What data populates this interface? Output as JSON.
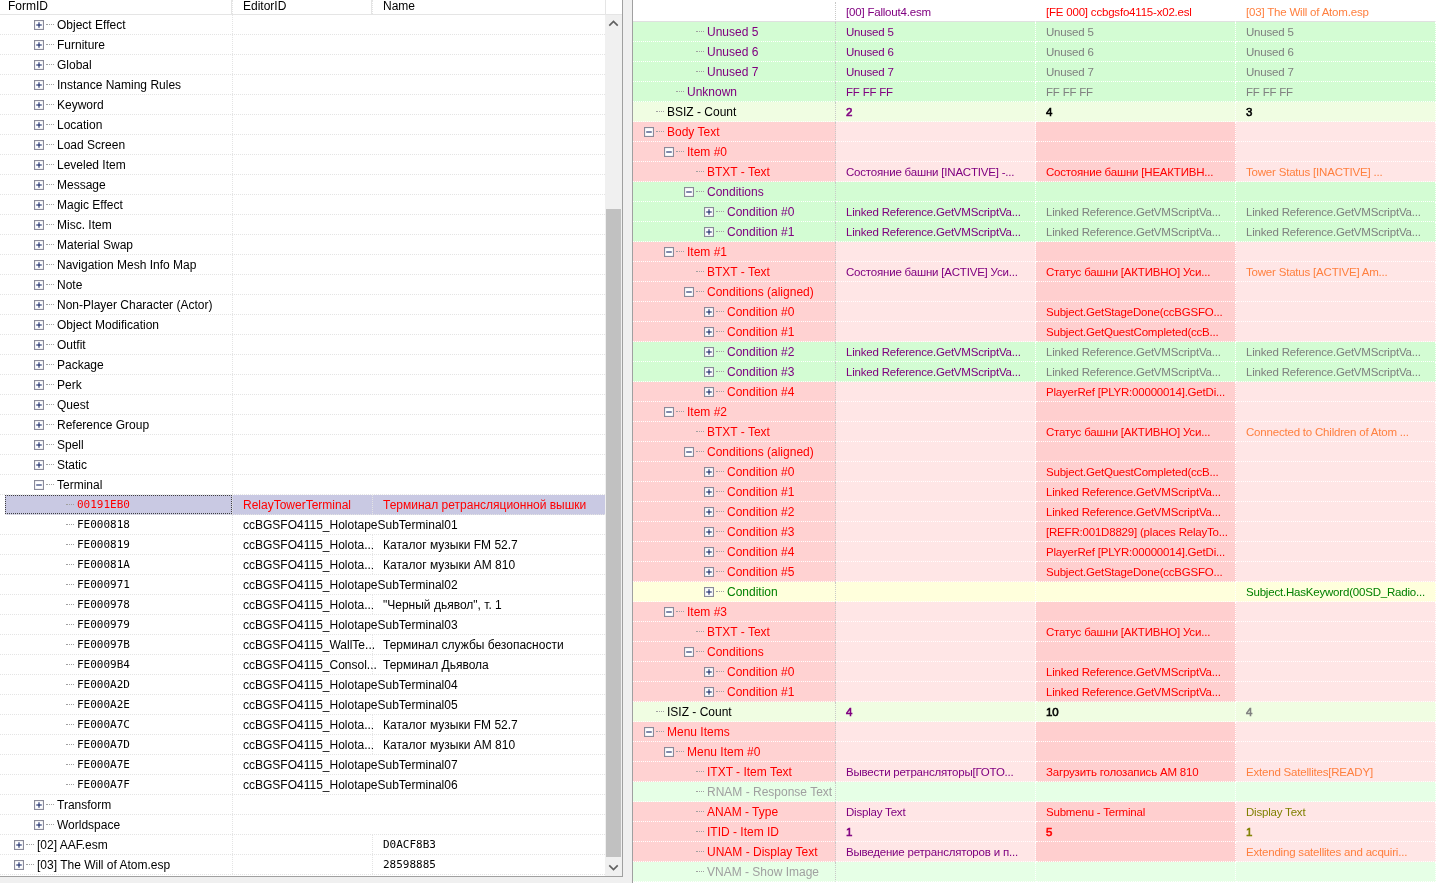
{
  "left_pane": {
    "columns": [
      "FormID",
      "EditorID",
      "Name"
    ],
    "tree": [
      {
        "children": [
          {
            "label": "Object Effect",
            "expanded": false
          },
          {
            "label": "Furniture",
            "expanded": false
          },
          {
            "label": "Global",
            "expanded": false
          },
          {
            "label": "Instance Naming Rules",
            "expanded": false
          },
          {
            "label": "Keyword",
            "expanded": false
          },
          {
            "label": "Location",
            "expanded": false
          },
          {
            "label": "Load Screen",
            "expanded": false
          },
          {
            "label": "Leveled Item",
            "expanded": false
          },
          {
            "label": "Message",
            "expanded": false
          },
          {
            "label": "Magic Effect",
            "expanded": false
          },
          {
            "label": "Misc. Item",
            "expanded": false
          },
          {
            "label": "Material Swap",
            "expanded": false
          },
          {
            "label": "Navigation Mesh Info Map",
            "expanded": false
          },
          {
            "label": "Note",
            "expanded": false
          },
          {
            "label": "Non-Player Character (Actor)",
            "expanded": false
          },
          {
            "label": "Object Modification",
            "expanded": false
          },
          {
            "label": "Outfit",
            "expanded": false
          },
          {
            "label": "Package",
            "expanded": false
          },
          {
            "label": "Perk",
            "expanded": false
          },
          {
            "label": "Quest",
            "expanded": false
          },
          {
            "label": "Reference Group",
            "expanded": false
          },
          {
            "label": "Spell",
            "expanded": false
          },
          {
            "label": "Static",
            "expanded": false
          },
          {
            "label": "Terminal",
            "expanded": true,
            "children": [
              {
                "form_id": "00191EB0",
                "editor_id": "RelayTowerTerminal",
                "name": "Терминал ретрансляционной вышки",
                "selected": true
              },
              {
                "form_id": "FE000818",
                "editor_id": "ccBGSFO4115_HolotapeSubTerminal01",
                "selected": false
              },
              {
                "form_id": "FE000819",
                "editor_id": "ccBGSFO4115_Holota...",
                "name": "Каталог музыки FM 52.7",
                "selected": false
              },
              {
                "form_id": "FE00081A",
                "editor_id": "ccBGSFO4115_Holota...",
                "name": "Каталог музыки AM 810",
                "selected": false
              },
              {
                "form_id": "FE000971",
                "editor_id": "ccBGSFO4115_HolotapeSubTerminal02",
                "selected": false
              },
              {
                "form_id": "FE000978",
                "editor_id": "ccBGSFO4115_Holota...",
                "name": "\"Черный дьявол\", т. 1",
                "selected": false
              },
              {
                "form_id": "FE000979",
                "editor_id": "ccBGSFO4115_HolotapeSubTerminal03",
                "selected": false
              },
              {
                "form_id": "FE00097B",
                "editor_id": "ccBGSFO4115_WallTe...",
                "name": "Терминал службы безопасности",
                "selected": false
              },
              {
                "form_id": "FE0009B4",
                "editor_id": "ccBGSFO4115_Consol...",
                "name": "Терминал Дьявола",
                "selected": false
              },
              {
                "form_id": "FE000A2D",
                "editor_id": "ccBGSFO4115_HolotapeSubTerminal04",
                "selected": false
              },
              {
                "form_id": "FE000A2E",
                "editor_id": "ccBGSFO4115_HolotapeSubTerminal05",
                "selected": false
              },
              {
                "form_id": "FE000A7C",
                "editor_id": "ccBGSFO4115_Holota...",
                "name": "Каталог музыки FM 52.7",
                "selected": false
              },
              {
                "form_id": "FE000A7D",
                "editor_id": "ccBGSFO4115_Holota...",
                "name": "Каталог музыки AM 810",
                "selected": false
              },
              {
                "form_id": "FE000A7E",
                "editor_id": "ccBGSFO4115_HolotapeSubTerminal07",
                "selected": false
              },
              {
                "form_id": "FE000A7F",
                "editor_id": "ccBGSFO4115_HolotapeSubTerminal06",
                "selected": false
              }
            ]
          },
          {
            "label": "Transform",
            "expanded": false
          },
          {
            "label": "Worldspace",
            "expanded": false
          }
        ]
      },
      {
        "label": "[02] AAF.esm",
        "expanded": false,
        "name": "D0ACF8B3"
      },
      {
        "label": "[03] The Will of Atom.esp",
        "expanded": false,
        "name": "28598885"
      }
    ]
  },
  "right_pane": {
    "columns": [
      {
        "label": "[00] Fallout4.esm",
        "color": "#800080"
      },
      {
        "label": "[FE 000] ccbgsfo4115-x02.esl",
        "color": "#ff0000"
      },
      {
        "label": "[03] The Will of Atom.esp",
        "color": "#ff8040"
      }
    ],
    "records": [
      {
        "children": [
          {
            "children": [
              {
                "label": "Unused 5",
                "color": "#800080",
                "kind": "match",
                "fallout4": {
                  "text": "Unused 5",
                  "color": "#800080"
                },
                "ccbgsfo4115": {
                  "text": "Unused 5",
                  "color": "#808080"
                },
                "will_of_atom": {
                  "text": "Unused 5",
                  "color": "#808080"
                }
              },
              {
                "label": "Unused 6",
                "color": "#800080",
                "kind": "match",
                "fallout4": {
                  "text": "Unused 6",
                  "color": "#800080"
                },
                "ccbgsfo4115": {
                  "text": "Unused 6",
                  "color": "#808080"
                },
                "will_of_atom": {
                  "text": "Unused 6",
                  "color": "#808080"
                }
              },
              {
                "label": "Unused 7",
                "color": "#800080",
                "kind": "match",
                "fallout4": {
                  "text": "Unused 7",
                  "color": "#800080"
                },
                "ccbgsfo4115": {
                  "text": "Unused 7",
                  "color": "#808080"
                },
                "will_of_atom": {
                  "text": "Unused 7",
                  "color": "#808080"
                }
              }
            ]
          },
          {
            "label": "Unknown",
            "color": "#800080",
            "kind": "match",
            "fallout4": {
              "text": "FF FF FF",
              "color": "#800080"
            },
            "ccbgsfo4115": {
              "text": "FF FF FF",
              "color": "#808080"
            },
            "will_of_atom": {
              "text": "FF FF FF",
              "color": "#808080"
            }
          }
        ]
      },
      {
        "label": "BSIZ - Count",
        "color": "#000000",
        "kind": "benign",
        "fallout4": {
          "text": "2",
          "color": "#800080"
        },
        "ccbgsfo4115": {
          "text": "4",
          "color": "#000000"
        },
        "will_of_atom": {
          "text": "3",
          "color": "#000000"
        }
      },
      {
        "label": "Body Text",
        "color": "#ff0000",
        "kind": "conflict",
        "expanded": true,
        "children": [
          {
            "label": "Item #0",
            "color": "#ff0000",
            "kind": "conflict",
            "expanded": true,
            "children": [
              {
                "label": "BTXT - Text",
                "color": "#ff0000",
                "kind": "conflict",
                "fallout4": {
                  "text": "Состояние башни [INACTIVE] -...",
                  "color": "#800080"
                },
                "ccbgsfo4115": {
                  "text": "Состояние башни [НЕАКТИВН...",
                  "color": "#ff0000"
                },
                "will_of_atom": {
                  "text": "Tower Status [INACTIVE] ...",
                  "color": "#ff8040"
                }
              },
              {
                "label": "Conditions",
                "color": "#800080",
                "kind": "match",
                "expanded": true,
                "children": [
                  {
                    "label": "Condition #0",
                    "color": "#800080",
                    "kind": "match",
                    "expanded": false,
                    "fallout4": {
                      "text": "Linked Reference.GetVMScriptVa...",
                      "color": "#800080"
                    },
                    "ccbgsfo4115": {
                      "text": "Linked Reference.GetVMScriptVa...",
                      "color": "#808080"
                    },
                    "will_of_atom": {
                      "text": "Linked Reference.GetVMScriptVa...",
                      "color": "#808080"
                    }
                  },
                  {
                    "label": "Condition #1",
                    "color": "#800080",
                    "kind": "match",
                    "expanded": false,
                    "fallout4": {
                      "text": "Linked Reference.GetVMScriptVa...",
                      "color": "#800080"
                    },
                    "ccbgsfo4115": {
                      "text": "Linked Reference.GetVMScriptVa...",
                      "color": "#808080"
                    },
                    "will_of_atom": {
                      "text": "Linked Reference.GetVMScriptVa...",
                      "color": "#808080"
                    }
                  }
                ]
              }
            ]
          },
          {
            "label": "Item #1",
            "color": "#ff0000",
            "kind": "conflict",
            "expanded": true,
            "children": [
              {
                "label": "BTXT - Text",
                "color": "#ff0000",
                "kind": "conflict",
                "fallout4": {
                  "text": "Состояние башни [ACTIVE] Уси...",
                  "color": "#800080"
                },
                "ccbgsfo4115": {
                  "text": "Статус башни [АКТИВНО] Уси...",
                  "color": "#ff0000"
                },
                "will_of_atom": {
                  "text": "Tower Status [ACTIVE] Am...",
                  "color": "#ff8040"
                }
              },
              {
                "label": "Conditions (aligned)",
                "color": "#ff0000",
                "kind": "conflict",
                "expanded": true,
                "children": [
                  {
                    "label": "Condition #0",
                    "color": "#ff0000",
                    "kind": "conflict",
                    "expanded": false,
                    "ccbgsfo4115": {
                      "text": "Subject.GetStageDone(ccBGSFO...",
                      "color": "#ff0000"
                    }
                  },
                  {
                    "label": "Condition #1",
                    "color": "#ff0000",
                    "kind": "conflict",
                    "expanded": false,
                    "ccbgsfo4115": {
                      "text": "Subject.GetQuestCompleted(ccB...",
                      "color": "#ff0000"
                    }
                  },
                  {
                    "label": "Condition #2",
                    "color": "#800080",
                    "kind": "match",
                    "expanded": false,
                    "fallout4": {
                      "text": "Linked Reference.GetVMScriptVa...",
                      "color": "#800080"
                    },
                    "ccbgsfo4115": {
                      "text": "Linked Reference.GetVMScriptVa...",
                      "color": "#808080"
                    },
                    "will_of_atom": {
                      "text": "Linked Reference.GetVMScriptVa...",
                      "color": "#808080"
                    }
                  },
                  {
                    "label": "Condition #3",
                    "color": "#800080",
                    "kind": "match",
                    "expanded": false,
                    "fallout4": {
                      "text": "Linked Reference.GetVMScriptVa...",
                      "color": "#800080"
                    },
                    "ccbgsfo4115": {
                      "text": "Linked Reference.GetVMScriptVa...",
                      "color": "#808080"
                    },
                    "will_of_atom": {
                      "text": "Linked Reference.GetVMScriptVa...",
                      "color": "#808080"
                    }
                  },
                  {
                    "label": "Condition #4",
                    "color": "#ff0000",
                    "kind": "conflict",
                    "expanded": false,
                    "ccbgsfo4115": {
                      "text": "PlayerRef [PLYR:00000014].GetDi...",
                      "color": "#ff0000"
                    }
                  }
                ]
              }
            ]
          },
          {
            "label": "Item #2",
            "color": "#ff0000",
            "kind": "conflict",
            "expanded": true,
            "children": [
              {
                "label": "BTXT - Text",
                "color": "#ff0000",
                "kind": "conflict",
                "ccbgsfo4115": {
                  "text": "Статус башни [АКТИВНО] Уси...",
                  "color": "#ff0000"
                },
                "will_of_atom": {
                  "text": "Connected to Children of Atom ...",
                  "color": "#ff8040"
                }
              },
              {
                "label": "Conditions (aligned)",
                "color": "#ff0000",
                "kind": "conflict",
                "expanded": true,
                "children": [
                  {
                    "label": "Condition #0",
                    "color": "#ff0000",
                    "kind": "conflict",
                    "expanded": false,
                    "ccbgsfo4115": {
                      "text": "Subject.GetQuestCompleted(ccB...",
                      "color": "#ff0000"
                    }
                  },
                  {
                    "label": "Condition #1",
                    "color": "#ff0000",
                    "kind": "conflict",
                    "expanded": false,
                    "ccbgsfo4115": {
                      "text": "Linked Reference.GetVMScriptVa...",
                      "color": "#ff0000"
                    }
                  },
                  {
                    "label": "Condition #2",
                    "color": "#ff0000",
                    "kind": "conflict",
                    "expanded": false,
                    "ccbgsfo4115": {
                      "text": "Linked Reference.GetVMScriptVa...",
                      "color": "#ff0000"
                    }
                  },
                  {
                    "label": "Condition #3",
                    "color": "#ff0000",
                    "kind": "conflict",
                    "expanded": false,
                    "ccbgsfo4115": {
                      "text": "[REFR:001D8829] (places RelayTo...",
                      "color": "#ff0000"
                    }
                  },
                  {
                    "label": "Condition #4",
                    "color": "#ff0000",
                    "kind": "conflict",
                    "expanded": false,
                    "ccbgsfo4115": {
                      "text": "PlayerRef [PLYR:00000014].GetDi...",
                      "color": "#ff0000"
                    }
                  },
                  {
                    "label": "Condition #5",
                    "color": "#ff0000",
                    "kind": "conflict",
                    "expanded": false,
                    "ccbgsfo4115": {
                      "text": "Subject.GetStageDone(ccBGSFO...",
                      "color": "#ff0000"
                    }
                  },
                  {
                    "label": "Condition",
                    "color": "#008000",
                    "kind": "override",
                    "expanded": false,
                    "will_of_atom": {
                      "text": "Subject.HasKeyword(00SD_Radio...",
                      "color": "#008000"
                    }
                  }
                ]
              }
            ]
          },
          {
            "label": "Item #3",
            "color": "#ff0000",
            "kind": "conflict",
            "expanded": true,
            "children": [
              {
                "label": "BTXT - Text",
                "color": "#ff0000",
                "kind": "conflict",
                "ccbgsfo4115": {
                  "text": "Статус башни [АКТИВНО] Уси...",
                  "color": "#ff0000"
                }
              },
              {
                "label": "Conditions",
                "color": "#ff0000",
                "kind": "conflict",
                "expanded": true,
                "children": [
                  {
                    "label": "Condition #0",
                    "color": "#ff0000",
                    "kind": "conflict",
                    "expanded": false,
                    "ccbgsfo4115": {
                      "text": "Linked Reference.GetVMScriptVa...",
                      "color": "#ff0000"
                    }
                  },
                  {
                    "label": "Condition #1",
                    "color": "#ff0000",
                    "kind": "conflict",
                    "expanded": false,
                    "ccbgsfo4115": {
                      "text": "Linked Reference.GetVMScriptVa...",
                      "color": "#ff0000"
                    }
                  }
                ]
              }
            ]
          }
        ]
      },
      {
        "label": "ISIZ - Count",
        "color": "#000000",
        "kind": "benign",
        "fallout4": {
          "text": "4",
          "color": "#800080"
        },
        "ccbgsfo4115": {
          "text": "10",
          "color": "#000000"
        },
        "will_of_atom": {
          "text": "4",
          "color": "#808080"
        }
      },
      {
        "label": "Menu Items",
        "color": "#ff0000",
        "kind": "conflict",
        "expanded": true,
        "children": [
          {
            "label": "Menu Item #0",
            "color": "#ff0000",
            "kind": "conflict",
            "expanded": true,
            "children": [
              {
                "label": "ITXT - Item Text",
                "color": "#ff0000",
                "kind": "conflict",
                "fallout4": {
                  "text": "Вывести ретрансляторы[ГОТО...",
                  "color": "#800080"
                },
                "ccbgsfo4115": {
                  "text": "Загрузить голозапись AM 810",
                  "color": "#ff0000"
                },
                "will_of_atom": {
                  "text": "Extend Satellites[READY]",
                  "color": "#ff8040"
                }
              },
              {
                "label": "RNAM - Response Text",
                "color": "#a0a0a0",
                "kind": "unused"
              },
              {
                "label": "ANAM - Type",
                "color": "#ff0000",
                "kind": "conflict",
                "fallout4": {
                  "text": "Display Text",
                  "color": "#800080"
                },
                "ccbgsfo4115": {
                  "text": "Submenu - Terminal",
                  "color": "#ff0000"
                },
                "will_of_atom": {
                  "text": "Display Text",
                  "color": "#808000"
                }
              },
              {
                "label": "ITID - Item ID",
                "color": "#ff0000",
                "kind": "conflict",
                "fallout4": {
                  "text": "1",
                  "color": "#800080"
                },
                "ccbgsfo4115": {
                  "text": "5",
                  "color": "#ff0000"
                },
                "will_of_atom": {
                  "text": "1",
                  "color": "#808000"
                }
              },
              {
                "label": "UNAM - Display Text",
                "color": "#ff0000",
                "kind": "conflict",
                "fallout4": {
                  "text": "Выведение ретрансляторов и п...",
                  "color": "#800080"
                },
                "will_of_atom": {
                  "text": "Extending satellites and acquiri...",
                  "color": "#ff8040"
                }
              },
              {
                "label": "VNAM - Show Image",
                "color": "#a0a0a0",
                "kind": "unused"
              }
            ]
          }
        ]
      }
    ]
  }
}
